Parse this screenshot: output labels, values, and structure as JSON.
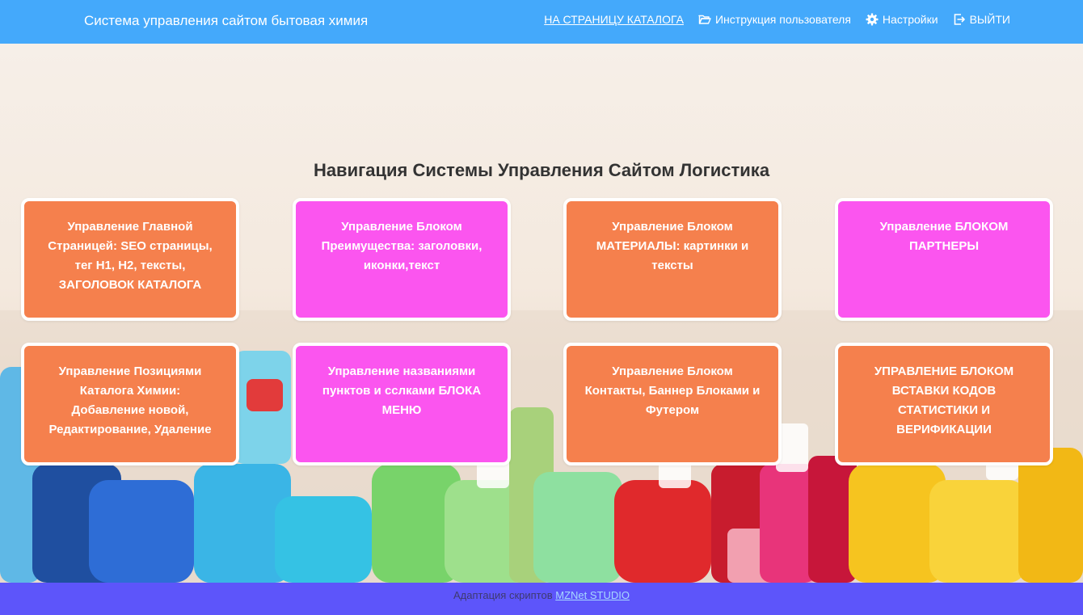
{
  "header": {
    "brand": "Система управления сайтом бытовая химия",
    "nav": {
      "catalog": "НА СТРАНИЦУ КАТАЛОГА",
      "manual": "Инструкция пользователя",
      "settings": "Настройки",
      "logout": "ВЫЙТИ"
    },
    "icons": {
      "manual": "folder-open-icon",
      "settings": "gear-icon",
      "logout": "sign-out-icon"
    }
  },
  "main": {
    "title": "Навигация Системы Управления Сайтом Логистика",
    "cards": [
      {
        "label": "Управление Главной Страницей: SEO страницы, тег H1, H2, тексты, ЗАГОЛОВОК КАТАЛОГА",
        "color": "#f5804d"
      },
      {
        "label": "Управление Блоком Преимущества: заголовки, иконки,текст",
        "color": "#fb55ef"
      },
      {
        "label": "Управление Блоком МАТЕРИАЛЫ: картинки и тексты",
        "color": "#f5804d"
      },
      {
        "label": "Управление БЛОКОМ ПАРТНЕРЫ",
        "color": "#fb55ef"
      },
      {
        "label": "Управление Позициями Каталога Химии: Добавление новой, Редактирование, Удаление",
        "color": "#f5804d"
      },
      {
        "label": "Управление названиями пунктов и сслками БЛОКА МЕНЮ",
        "color": "#fb55ef"
      },
      {
        "label": "Управление Блоком Контакты, Баннер Блоками и Футером",
        "color": "#f5804d"
      },
      {
        "label": "УПРАВЛЕНИЕ БЛОКОМ ВСТАВКИ КОДОВ СТАТИСТИКИ И ВЕРИФИКАЦИИ",
        "color": "#f5804d"
      }
    ]
  },
  "footer": {
    "text": "Адаптация скриптов",
    "link": "MZNet STUDIO"
  },
  "colors": {
    "header": "#44a9fb",
    "footer": "#5d55fa",
    "orange": "#f5804d",
    "pink": "#fb55ef"
  }
}
